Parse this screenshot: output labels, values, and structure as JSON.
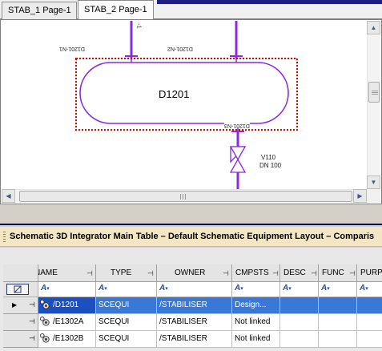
{
  "tabs": [
    {
      "label": "STAB_1 Page-1",
      "active": false
    },
    {
      "label": "STAB_2 Page-1",
      "active": true
    }
  ],
  "drawing": {
    "vessel_label": "D1201",
    "nozzle_left": "D1201-N1",
    "nozzle_right": "D1201-N2",
    "nozzle_bottom": "D1201-N3",
    "top_pipe_label": "-1",
    "valve_tag": "V110",
    "valve_size": "DN 100",
    "colors": {
      "pipe": "#8a2be2",
      "vessel": "#8a2be2",
      "selection": "#e00000"
    }
  },
  "main_table": {
    "title": "Schematic 3D Integrator Main Table – Default Schematic Equipment Layout – Comparis",
    "columns": [
      "NAME",
      "TYPE",
      "OWNER",
      "CMPSTS",
      "DESC",
      "FUNC",
      "PURP"
    ],
    "filter_icon": "filter-clear-icon",
    "rows": [
      {
        "name": "/D1201",
        "type": "SCEQUI",
        "owner": "/STABILISER",
        "cmpsts": "Design...",
        "selected": true
      },
      {
        "name": "/E1302A",
        "type": "SCEQUI",
        "owner": "/STABILISER",
        "cmpsts": "Not linked",
        "selected": false
      },
      {
        "name": "/E1302B",
        "type": "SCEQUI",
        "owner": "/STABILISER",
        "cmpsts": "Not linked",
        "selected": false
      }
    ]
  }
}
